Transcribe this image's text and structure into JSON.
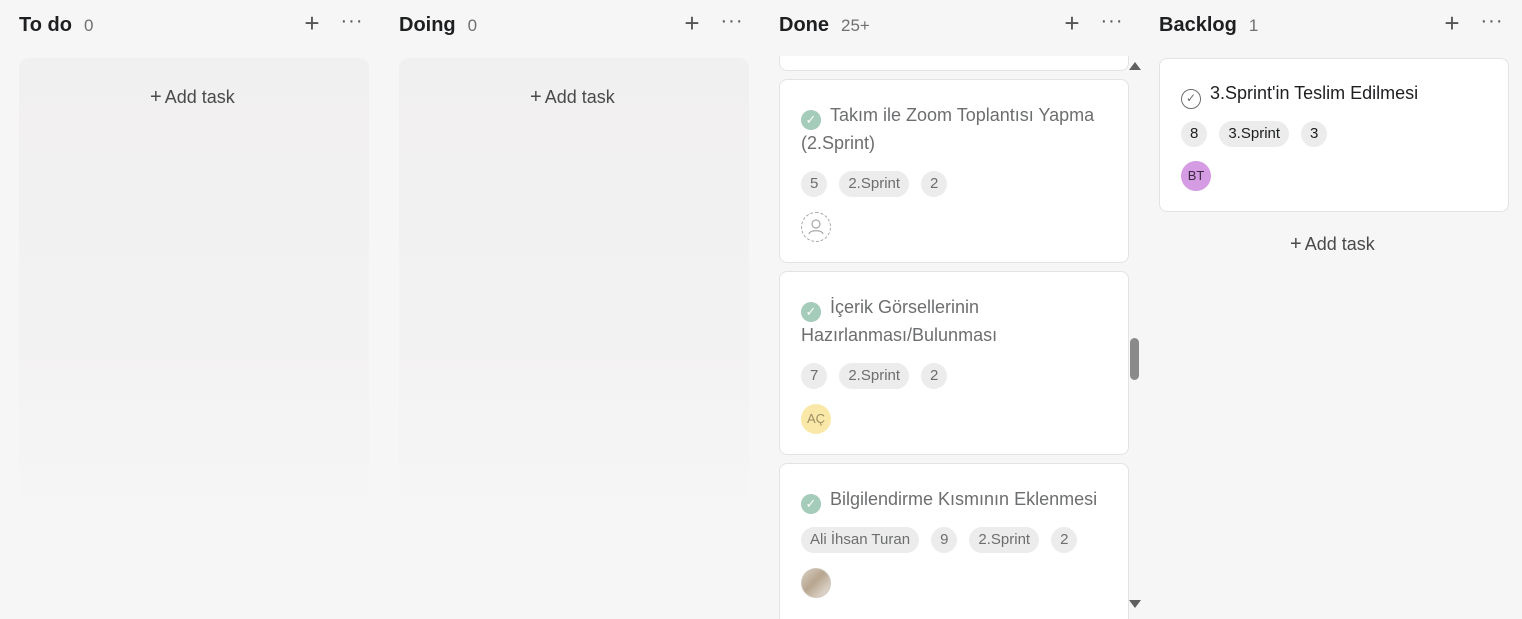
{
  "columns": {
    "todo": {
      "title": "To do",
      "count": "0",
      "add_task": "Add task"
    },
    "doing": {
      "title": "Doing",
      "count": "0",
      "add_task": "Add task"
    },
    "done": {
      "title": "Done",
      "count": "25+",
      "cards": [
        {
          "title": "Takım ile Zoom Toplantısı Yapma (2.Sprint)",
          "pills": [
            "5",
            "2.Sprint",
            "2"
          ],
          "avatar": ""
        },
        {
          "title": "İçerik Görsellerinin Hazırlanması/Bulunması",
          "pills": [
            "7",
            "2.Sprint",
            "2"
          ],
          "avatar": "AÇ"
        },
        {
          "title": "Bilgilendirme Kısmının Eklenmesi",
          "pills": [
            "Ali İhsan Turan",
            "9",
            "2.Sprint",
            "2"
          ],
          "avatar": ""
        }
      ]
    },
    "backlog": {
      "title": "Backlog",
      "count": "1",
      "add_task": "Add task",
      "cards": [
        {
          "title": "3.Sprint'in Teslim Edilmesi",
          "pills": [
            "8",
            "3.Sprint",
            "3"
          ],
          "avatar": "BT"
        }
      ]
    }
  },
  "icons": {
    "plus": "+",
    "more": "···",
    "check": "✓",
    "person": "person-icon"
  },
  "colors": {
    "check_green": "#5da283",
    "avatar_ac": "#f8e49a",
    "avatar_bt": "#d59be3",
    "background": "#f6f6f6"
  }
}
